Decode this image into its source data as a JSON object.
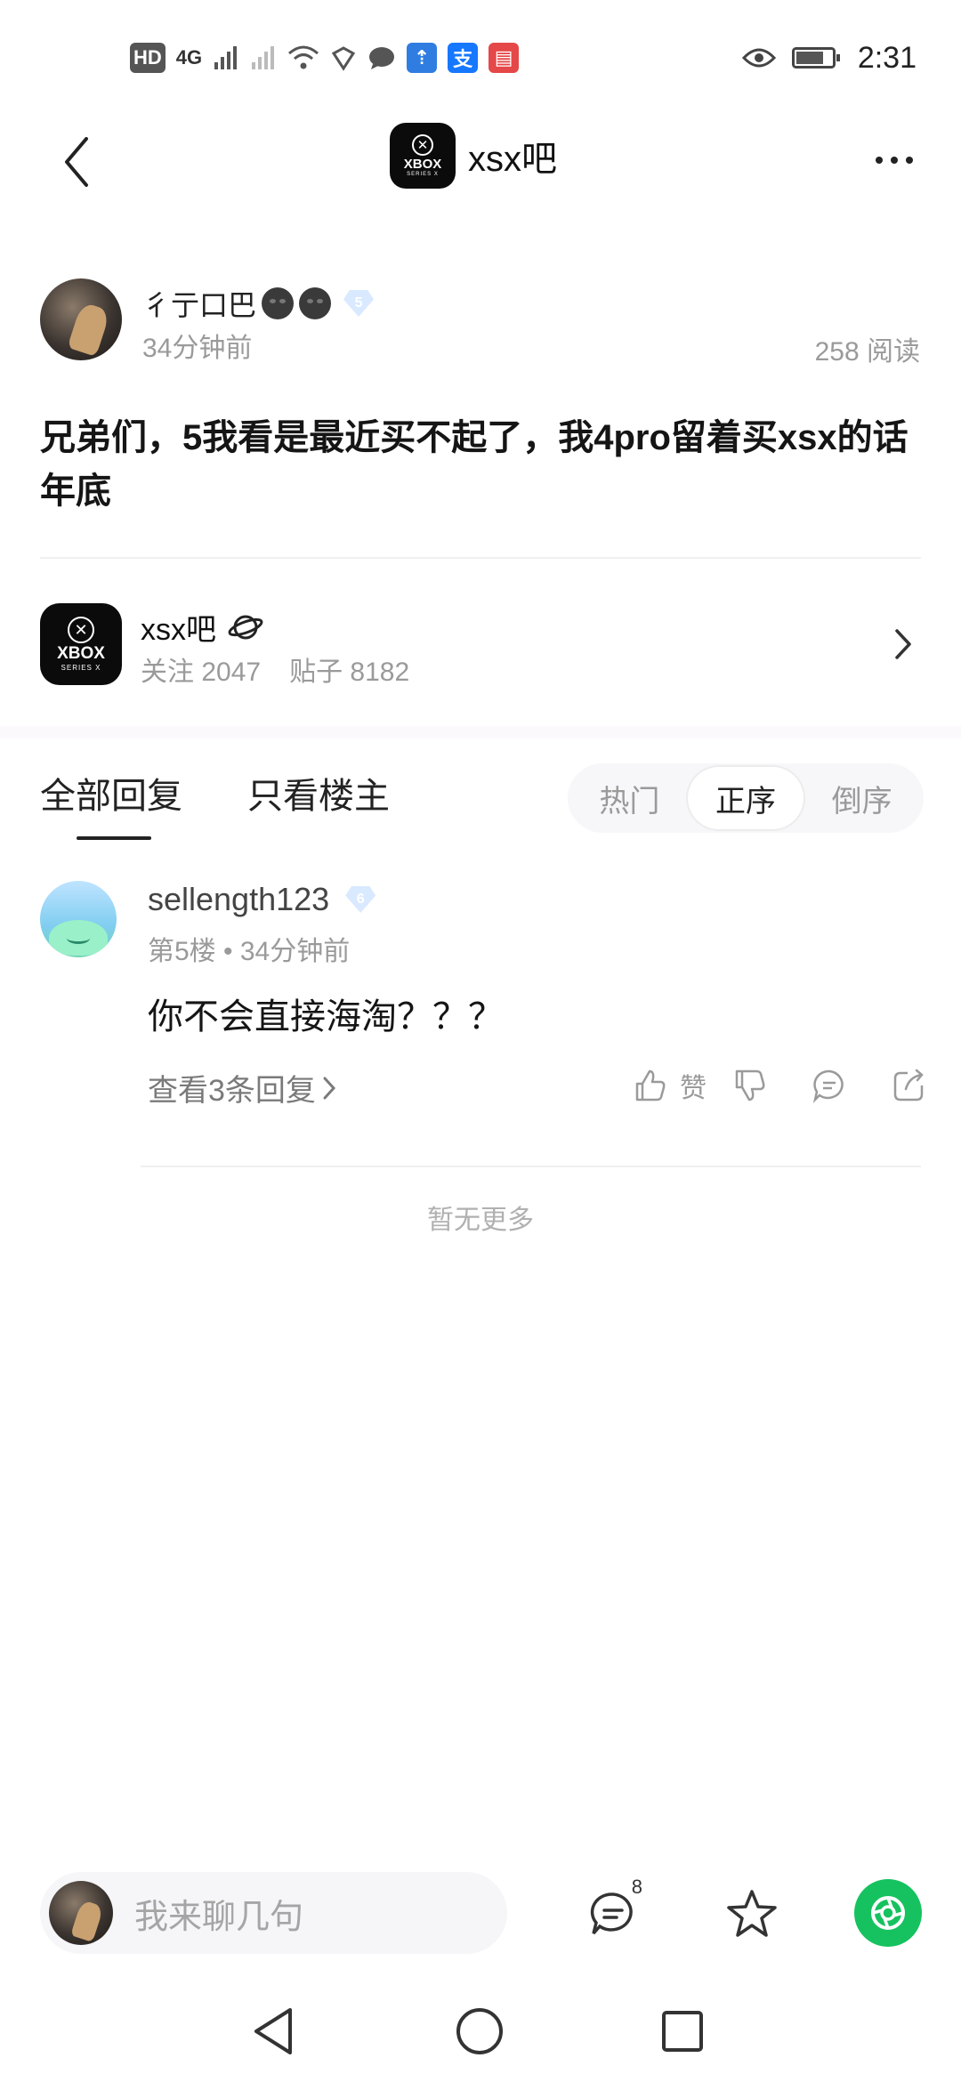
{
  "status_bar": {
    "network_hd": "HD",
    "network_4g": "4G",
    "time": "2:31"
  },
  "nav": {
    "title": "xsx吧",
    "logo_text": "XBOX",
    "logo_subtext": "SERIES X"
  },
  "post": {
    "author_name": "彳亍口巴",
    "level": "5",
    "time_ago": "34分钟前",
    "read_count": "258 阅读",
    "title": "兄弟们，5我看是最近买不起了，我4pro留着买xsx的话年底"
  },
  "forum": {
    "name": "xsx吧",
    "followers": "关注 2047",
    "posts": "贴子 8182"
  },
  "tabs": {
    "all": "全部回复",
    "owner_only": "只看楼主",
    "sort_hot": "热门",
    "sort_asc": "正序",
    "sort_desc": "倒序"
  },
  "replies": [
    {
      "username": "sellength123",
      "level": "6",
      "floor_time": "第5楼 • 34分钟前",
      "text": "你不会直接海淘？？？",
      "view_replies": "查看3条回复",
      "like_label": "赞"
    }
  ],
  "no_more": "暂无更多",
  "bottom_bar": {
    "input_placeholder": "我来聊几句",
    "comment_count": "8"
  },
  "colors": {
    "accent_green": "#16c25f",
    "badge_blue": "#d9e9ff",
    "muted_text": "#9a9a9a"
  }
}
